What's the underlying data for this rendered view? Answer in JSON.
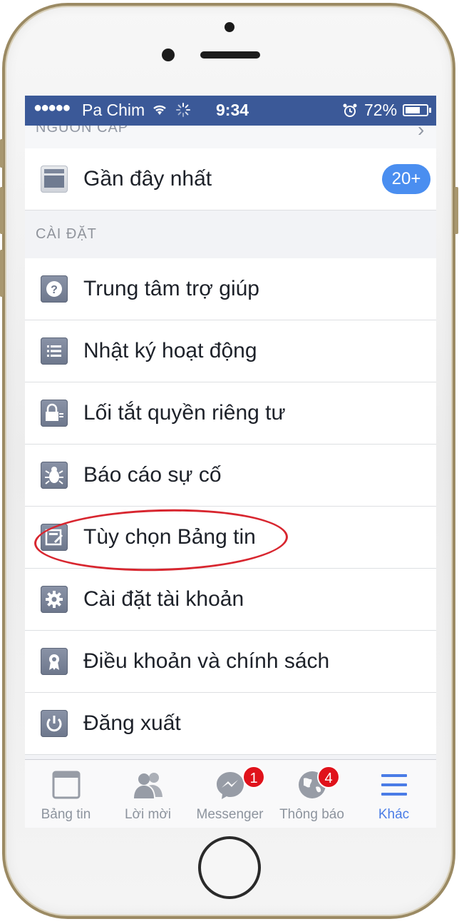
{
  "status_bar": {
    "signal": "●●●●●",
    "carrier": "Pa Chim",
    "time": "9:34",
    "battery": "72%",
    "battery_level": 0.72
  },
  "ghost_header": {
    "text": "NGUỒN CẤP"
  },
  "recent_row": {
    "label": "Gần đây nhất",
    "badge": "20+"
  },
  "section": {
    "title": "CÀI ĐẶT"
  },
  "settings_items": [
    {
      "label": "Trung tâm trợ giúp",
      "icon": "help-icon"
    },
    {
      "label": "Nhật ký hoạt động",
      "icon": "activity-log-icon"
    },
    {
      "label": "Lối tắt quyền riêng tư",
      "icon": "privacy-lock-icon"
    },
    {
      "label": "Báo cáo sự cố",
      "icon": "bug-icon"
    },
    {
      "label": "Tùy chọn Bảng tin",
      "icon": "news-feed-preferences-icon",
      "highlighted": true
    },
    {
      "label": "Cài đặt tài khoản",
      "icon": "gear-icon"
    },
    {
      "label": "Điều khoản và chính sách",
      "icon": "terms-badge-icon"
    },
    {
      "label": "Đăng xuất",
      "icon": "power-icon"
    }
  ],
  "tabbar": {
    "tabs": [
      {
        "label": "Bảng tin",
        "icon": "news-feed-icon"
      },
      {
        "label": "Lời mời",
        "icon": "friend-requests-icon"
      },
      {
        "label": "Messenger",
        "icon": "messenger-icon",
        "badge": "1"
      },
      {
        "label": "Thông báo",
        "icon": "globe-icon",
        "badge": "4"
      },
      {
        "label": "Khác",
        "icon": "menu-icon",
        "active": true
      }
    ]
  },
  "colors": {
    "status_bar": "#3b5998",
    "badge_blue": "#4a8ef0",
    "badge_red": "#e0121b",
    "highlight": "#d8262f",
    "active_tab": "#4a7ce6"
  }
}
